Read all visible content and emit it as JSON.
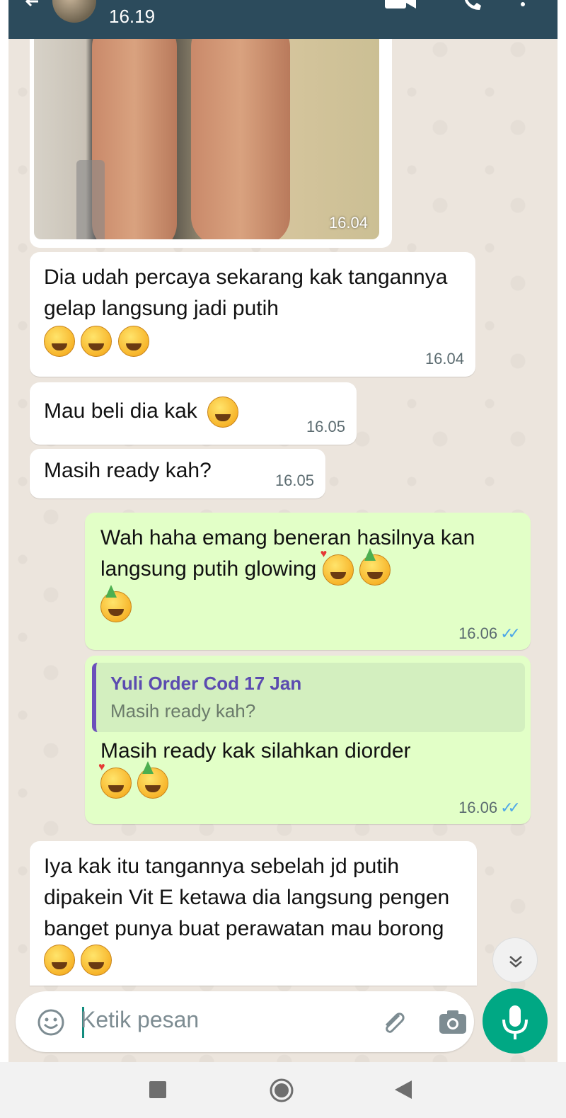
{
  "header": {
    "title": "16.19"
  },
  "messages": {
    "photo": {
      "time": "16.04"
    },
    "m1": {
      "text": "Dia udah percaya sekarang kak tangannya gelap langsung jadi putih",
      "time": "16.04"
    },
    "m2": {
      "text": "Mau beli dia kak",
      "time": "16.05"
    },
    "m3": {
      "text": "Masih ready kah?",
      "time": "16.05"
    },
    "m4": {
      "text": "Wah haha emang beneran hasilnya kan langsung putih glowing",
      "time": "16.06"
    },
    "m5": {
      "reply_author": "Yuli Order Cod 17 Jan",
      "reply_quote": "Masih ready kah?",
      "text": "Masih ready kak silahkan diorder",
      "time": "16.06"
    },
    "m6": {
      "text": "Iya kak itu tangannya sebelah jd putih dipakein Vit E ketawa dia langsung pengen banget  punya buat perawatan mau borong"
    }
  },
  "composer": {
    "placeholder": "Ketik pesan"
  },
  "colors": {
    "header": "#2c4b5c",
    "outgoing": "#e2ffc7",
    "incoming": "#ffffff",
    "accent": "#00a884",
    "read_ticks": "#4fa8e8"
  },
  "icons": [
    "back-arrow-icon",
    "video-call-icon",
    "phone-icon",
    "more-vert-icon",
    "emoji-icon",
    "attach-icon",
    "camera-icon",
    "mic-icon",
    "scroll-down-icon",
    "nav-recent-icon",
    "nav-home-icon",
    "nav-back-icon"
  ]
}
